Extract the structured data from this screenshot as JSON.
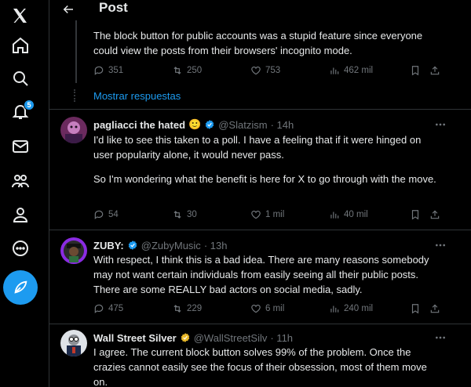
{
  "nav": {
    "items": [
      {
        "icon": "x-logo-icon"
      },
      {
        "icon": "home-icon"
      },
      {
        "icon": "search-icon"
      },
      {
        "icon": "bell-icon",
        "badge": "5"
      },
      {
        "icon": "mail-icon"
      },
      {
        "icon": "communities-icon"
      },
      {
        "icon": "profile-icon"
      },
      {
        "icon": "more-circle-icon"
      }
    ],
    "compose_icon": "feather-plus-icon",
    "accent": "#1d9bf0"
  },
  "header": {
    "title": "Post"
  },
  "top_post": {
    "text": "The block button for public accounts was a stupid feature since everyone could view the posts from their browsers' incognito mode.",
    "replies": "351",
    "reposts": "250",
    "likes": "753",
    "views": "462 mil",
    "show_replies": "Mostrar respuestas"
  },
  "posts": [
    {
      "name": "pagliacci the hated",
      "emoji": "🙂",
      "handle": "@Slatzism",
      "time": "· 14h",
      "verified_color": "#1d9bf0",
      "text1": "I'd like to see this taken to a poll. I have a feeling that if it were hinged on user popularity alone, it would never pass.",
      "text2": "So I'm wondering what the benefit is here for X to go through with the move.",
      "replies": "54",
      "reposts": "30",
      "likes": "1 mil",
      "views": "40 mil"
    },
    {
      "name": "ZUBY:",
      "handle": "@ZubyMusic",
      "time": "· 13h",
      "verified_color": "#1d9bf0",
      "text1": "With respect, I think this is a bad idea. There are many reasons somebody may not want certain individuals from easily seeing all their public posts. There are some REALLY bad actors on social media, sadly.",
      "replies": "475",
      "reposts": "229",
      "likes": "6 mil",
      "views": "240 mil"
    },
    {
      "name": "Wall Street Silver",
      "handle": "@WallStreetSilv",
      "time": "· 11h",
      "verified_color": "#e8b829",
      "text1": "I agree. The current block button solves 99% of the problem. Once the crazies cannot easily see the focus of their obsession, most of them move on."
    }
  ]
}
